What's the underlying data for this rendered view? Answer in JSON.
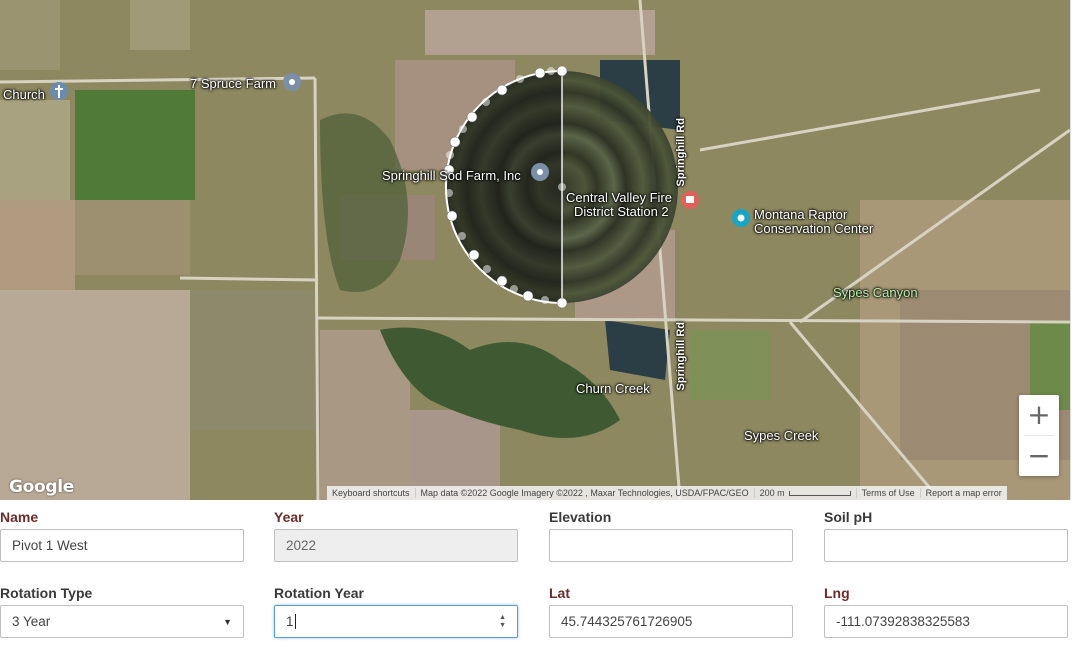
{
  "map": {
    "places": {
      "church": "Church",
      "spruce_farm": "7 Spruce Farm",
      "sod_farm": "Springhill Sod Farm, Inc",
      "fire_station_line1": "Central Valley Fire",
      "fire_station_line2": "District Station 2",
      "raptor_line1": "Montana Raptor",
      "raptor_line2": "Conservation Center",
      "sypes_canyon": "Sypes Canyon",
      "churn_creek": "Churn Creek",
      "sypes_creek": "Sypes Creek",
      "springhill_rd_upper": "Springhill Rd",
      "springhill_rd_lower": "Springhill Rd"
    },
    "logo": "Google",
    "zoom_in_label": "+",
    "zoom_out_label": "−",
    "attribution": {
      "shortcuts": "Keyboard shortcuts",
      "map_data": "Map data ©2022 Google Imagery ©2022 , Maxar Technologies, USDA/FPAC/GEO",
      "scale": "200 m",
      "terms": "Terms of Use",
      "report": "Report a map error"
    }
  },
  "form": {
    "name": {
      "label": "Name",
      "value": "Pivot 1 West"
    },
    "year": {
      "label": "Year",
      "value": "2022"
    },
    "elevation": {
      "label": "Elevation",
      "value": ""
    },
    "soil_ph": {
      "label": "Soil pH",
      "value": ""
    },
    "rotation_type": {
      "label": "Rotation Type",
      "value": "3 Year"
    },
    "rotation_year": {
      "label": "Rotation Year",
      "value": "1"
    },
    "lat": {
      "label": "Lat",
      "value": "45.744325761726905"
    },
    "lng": {
      "label": "Lng",
      "value": "-111.07392838325583"
    }
  },
  "colors": {
    "required_label": "#6b2c2c",
    "focus_border": "#5b9bd5"
  }
}
